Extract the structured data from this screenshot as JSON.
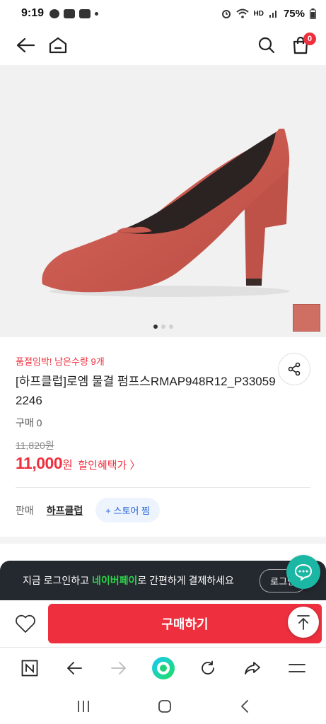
{
  "status_bar": {
    "time": "9:19",
    "battery": "75%",
    "network": "HD"
  },
  "top_nav": {
    "cart_count": "0"
  },
  "gallery": {
    "total_images": 3,
    "active_index": 0,
    "swatch_color": "#cf6e63"
  },
  "product": {
    "urgency": "품절임박! 남은수량 9개",
    "title": "[하프클럽]로엠 물결 펌프스RMAP948R12_P330592246",
    "sold": "구매 0",
    "original_price": "11,820원",
    "price_value": "11,000",
    "price_unit": "원",
    "benefit_link": "할인혜택가 〉",
    "seller_label": "판매",
    "seller_name": "하프클럽",
    "follow_label": "+ 스토어 찜"
  },
  "login_banner": {
    "text_before": "지금 로그인하고 ",
    "highlight": "네이버페이",
    "text_after": "로 간편하게 결제하세요",
    "login_button": "로그인"
  },
  "buy_bar": {
    "buy_label": "구매하기"
  },
  "colors": {
    "accent_red": "#ee2f3e",
    "naver_green": "#2fd44a",
    "chat_teal": "#1cb7a4"
  }
}
